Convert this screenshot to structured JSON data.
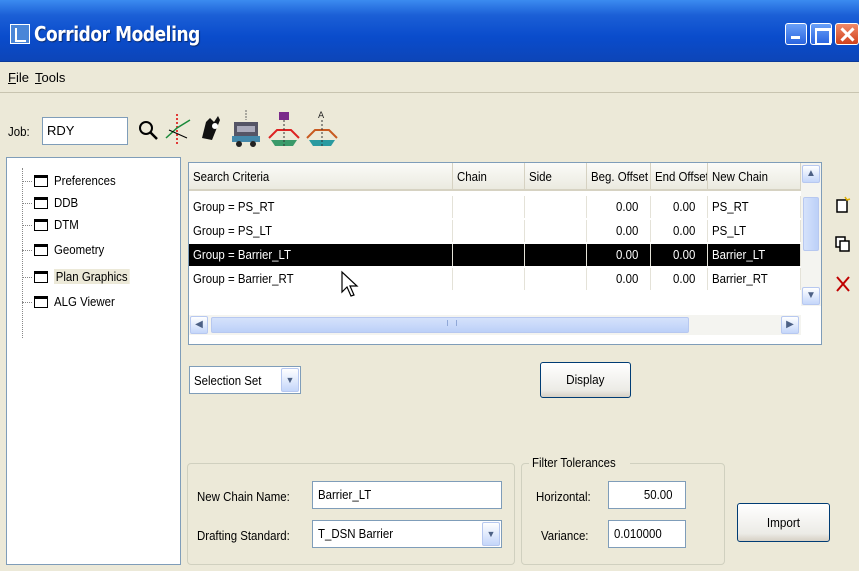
{
  "window": {
    "title": "Corridor Modeling"
  },
  "menu": {
    "file": "File",
    "tools": "Tools"
  },
  "job": {
    "label": "Job:",
    "value": "RDY"
  },
  "tree": [
    {
      "label": "Preferences"
    },
    {
      "label": "DDB"
    },
    {
      "label": "DTM"
    },
    {
      "label": "Geometry"
    },
    {
      "label": "Plan Graphics",
      "selected": true
    },
    {
      "label": "ALG Viewer"
    }
  ],
  "grid": {
    "columns": [
      "Search Criteria",
      "Chain",
      "Side",
      "Beg. Offset",
      "End Offset",
      "New Chain"
    ],
    "rows": [
      {
        "criteria": "Group = PS_RT",
        "chain": "",
        "side": "",
        "beg": "0.00",
        "end": "0.00",
        "new_chain": "PS_RT"
      },
      {
        "criteria": "Group = PS_LT",
        "chain": "",
        "side": "",
        "beg": "0.00",
        "end": "0.00",
        "new_chain": "PS_LT"
      },
      {
        "criteria": "Group = Barrier_LT",
        "chain": "",
        "side": "",
        "beg": "0.00",
        "end": "0.00",
        "new_chain": "Barrier_LT",
        "selected": true
      },
      {
        "criteria": "Group = Barrier_RT",
        "chain": "",
        "side": "",
        "beg": "0.00",
        "end": "0.00",
        "new_chain": "Barrier_RT"
      }
    ]
  },
  "selection": {
    "value": "Selection Set"
  },
  "buttons": {
    "display": "Display",
    "import": "Import"
  },
  "chain_group": {
    "new_chain_label": "New Chain Name:",
    "new_chain_value": "Barrier_LT",
    "drafting_label": "Drafting Standard:",
    "drafting_value": "T_DSN Barrier"
  },
  "filter": {
    "title": "Filter Tolerances",
    "horizontal_label": "Horizontal:",
    "horizontal_value": "50.00",
    "variance_label": "Variance:",
    "variance_value": "0.010000"
  },
  "icons": {
    "title_bar": [
      "app-icon",
      "minimize-icon",
      "maximize-icon",
      "close-icon"
    ],
    "toolbar": [
      "search-icon",
      "alignment-icon",
      "hand-icon",
      "vehicle-icon",
      "template-icon",
      "cross-section-icon"
    ],
    "side": [
      "new-icon",
      "copy-icon",
      "delete-icon"
    ]
  },
  "colors": {
    "titlebar": "#0a4ccc",
    "face": "#ece9d8",
    "selection": "#000000",
    "delete": "#c00000"
  }
}
